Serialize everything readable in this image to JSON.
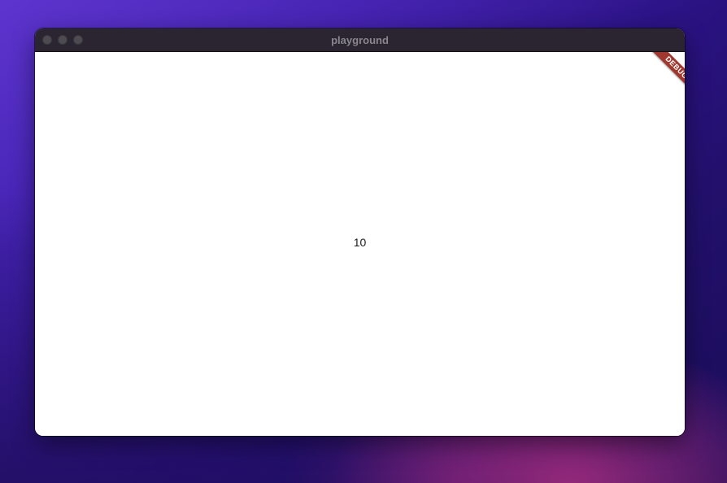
{
  "window": {
    "title": "playground"
  },
  "app": {
    "counter_value": "10",
    "debug_banner_label": "DEBUG"
  },
  "colors": {
    "titlebar": "#2a2530",
    "content_background": "#ffffff",
    "debug_banner": "#a0382f"
  }
}
